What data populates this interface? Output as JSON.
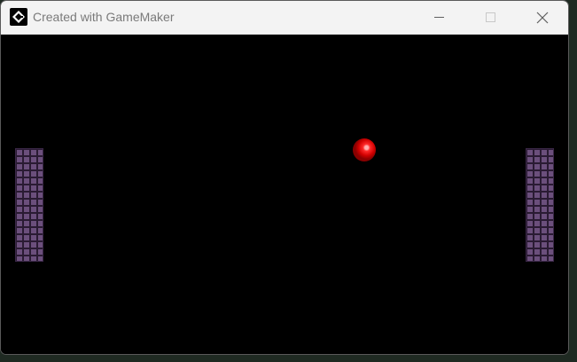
{
  "window": {
    "title": "Created with GameMaker",
    "controls": {
      "minimize_icon": "minimize-icon",
      "maximize_icon": "maximize-icon",
      "close_icon": "close-icon"
    },
    "app_icon": "gamemaker-logo-icon"
  },
  "game": {
    "background_color": "#000000",
    "entities": [
      {
        "type": "paddle",
        "side": "left",
        "sprite": "purple-brick-wall"
      },
      {
        "type": "paddle",
        "side": "right",
        "sprite": "purple-brick-wall"
      },
      {
        "type": "ball",
        "color": "#ff0000"
      }
    ]
  }
}
